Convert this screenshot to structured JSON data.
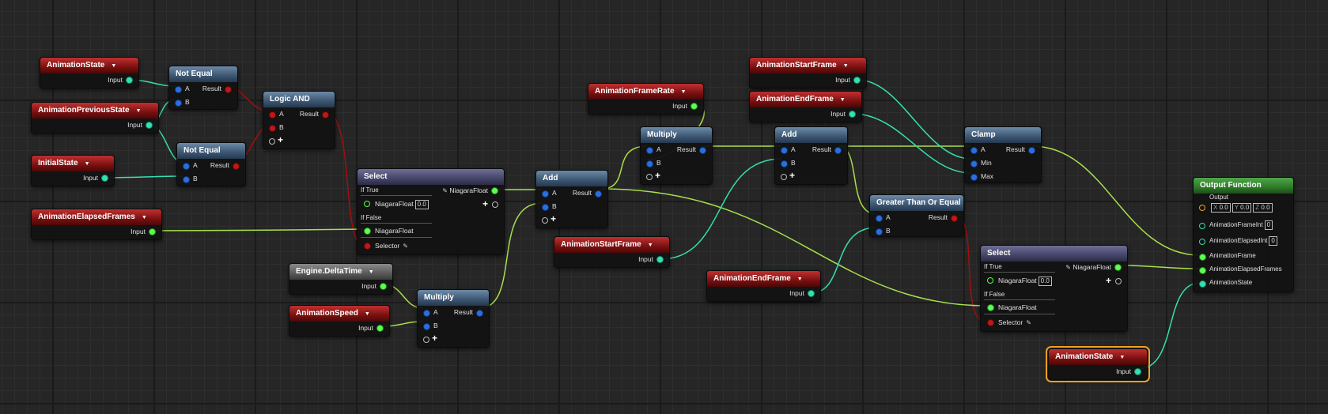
{
  "nodes": {
    "animation_state_1": {
      "title": "AnimationState",
      "pin": "Input"
    },
    "animation_previous_state": {
      "title": "AnimationPreviousState",
      "pin": "Input"
    },
    "initial_state": {
      "title": "InitialState",
      "pin": "Input"
    },
    "not_equal_1": {
      "title": "Not Equal",
      "a": "A",
      "b": "B",
      "result": "Result"
    },
    "not_equal_2": {
      "title": "Not Equal",
      "a": "A",
      "b": "B",
      "result": "Result"
    },
    "logic_and": {
      "title": "Logic AND",
      "a": "A",
      "b": "B",
      "result": "Result"
    },
    "animation_elapsed_frames": {
      "title": "AnimationElapsedFrames",
      "pin": "Input"
    },
    "select_1": {
      "title": "Select",
      "if_true": "If True",
      "if_false": "If False",
      "type": "NiagaraFloat",
      "true_value": "0.0",
      "false_label": "NiagaraFloat",
      "selector": "Selector",
      "output": "NiagaraFloat"
    },
    "engine_delta_time": {
      "title": "Engine.DeltaTime",
      "pin": "Input"
    },
    "animation_speed": {
      "title": "AnimationSpeed",
      "pin": "Input"
    },
    "multiply_1": {
      "title": "Multiply",
      "a": "A",
      "b": "B",
      "result": "Result"
    },
    "add_1": {
      "title": "Add",
      "a": "A",
      "b": "B",
      "result": "Result"
    },
    "animation_frame_rate": {
      "title": "AnimationFrameRate",
      "pin": "Input"
    },
    "multiply_2": {
      "title": "Multiply",
      "a": "A",
      "b": "B",
      "result": "Result"
    },
    "animation_start_frame_1": {
      "title": "AnimationStartFrame",
      "pin": "Input"
    },
    "animation_start_frame_2": {
      "title": "AnimationStartFrame",
      "pin": "Input"
    },
    "animation_end_frame_1": {
      "title": "AnimationEndFrame",
      "pin": "Input"
    },
    "animation_end_frame_2": {
      "title": "AnimationEndFrame",
      "pin": "Input"
    },
    "add_2": {
      "title": "Add",
      "a": "A",
      "b": "B",
      "result": "Result"
    },
    "clamp": {
      "title": "Clamp",
      "a": "A",
      "min": "Min",
      "max": "Max",
      "result": "Result"
    },
    "greater_than_or_equal": {
      "title": "Greater Than Or Equal",
      "a": "A",
      "b": "B",
      "result": "Result"
    },
    "select_2": {
      "title": "Select",
      "if_true": "If True",
      "if_false": "If False",
      "type": "NiagaraFloat",
      "true_value": "0.0",
      "false_label": "NiagaraFloat",
      "selector": "Selector",
      "output": "NiagaraFloat"
    },
    "animation_state_2": {
      "title": "AnimationState",
      "pin": "Input"
    },
    "output_function": {
      "title": "Output Function",
      "output_label": "Output",
      "x_label": "X",
      "x_value": "0.0",
      "y_label": "Y",
      "y_value": "0.0",
      "z_label": "Z",
      "z_value": "0.0",
      "frame_int_label": "AnimationFrameInt",
      "frame_int_value": "0",
      "elapsed_int_label": "AnimationElapsedInt",
      "elapsed_int_value": "0",
      "frame_label": "AnimationFrame",
      "elapsed_frames_label": "AnimationElapsedFrames",
      "state_label": "AnimationState"
    }
  },
  "colors": {
    "float_wire": "#a8e04a",
    "int_wire": "#35e0b0",
    "bool_wire": "#b01010",
    "param_header": "#8a1a1a",
    "op_header": "#3c5672",
    "output_header": "#2d7a28",
    "selection": "#f0a020"
  }
}
